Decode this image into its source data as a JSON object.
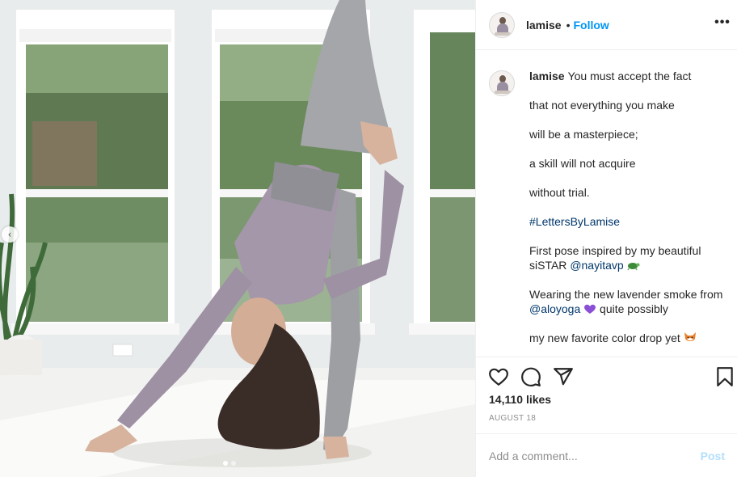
{
  "post": {
    "username": "lamise",
    "separator": "•",
    "follow_label": "Follow",
    "more_label": "•••"
  },
  "caption": {
    "username": "lamise",
    "lines": [
      "You must accept the fact",
      "that not everything you make",
      "will be a masterpiece;",
      "a skill will not acquire",
      "without trial.",
      "#LettersByLamise",
      "First pose inspired by my beautiful siSTAR",
      "@nayitavp",
      "Wearing the new lavender smoke from",
      "@aloyoga",
      "quite possibly",
      "my new favorite color drop yet"
    ]
  },
  "stats": {
    "likes": "14,110 likes",
    "date": "AUGUST 18"
  },
  "comment": {
    "placeholder": "Add a comment...",
    "post_label": "Post"
  },
  "carousel": {
    "prev_label": "‹",
    "slide_count": 2,
    "active_index": 0
  },
  "icons": {
    "like": "heart-icon",
    "comment": "comment-icon",
    "share": "share-icon",
    "save": "bookmark-icon"
  },
  "colors": {
    "link": "#00376b",
    "follow": "#0095f6",
    "post_disabled": "#b2dffc",
    "muted": "#8e8e8e",
    "outfit": "#9a8fa0"
  }
}
